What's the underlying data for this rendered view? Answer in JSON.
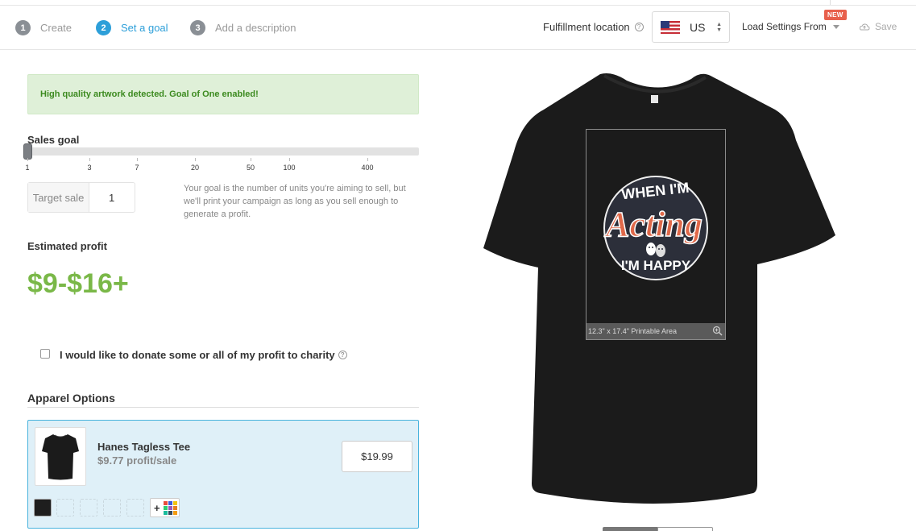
{
  "steps": [
    {
      "number": "1",
      "label": "Create"
    },
    {
      "number": "2",
      "label": "Set a goal"
    },
    {
      "number": "3",
      "label": "Add a description"
    }
  ],
  "header": {
    "fulfillment_label": "Fulfillment location",
    "country": "US",
    "load_settings_label": "Load Settings From",
    "new_badge": "NEW",
    "save_label": "Save"
  },
  "alert": {
    "text": "High quality artwork detected. Goal of One enabled!"
  },
  "sales_goal": {
    "label": "Sales goal",
    "ticks": [
      "1",
      "3",
      "7",
      "20",
      "50",
      "100",
      "400"
    ],
    "selected_value": 1,
    "target_label": "Target sale",
    "target_value": "1",
    "help_text": "Your goal is the number of units you're aiming to sell, but we'll print your campaign as long as you sell enough to generate a profit."
  },
  "estimated_profit": {
    "label": "Estimated profit",
    "value": "$9-$16+"
  },
  "donate": {
    "label": "I would like to donate some or all of my profit to charity",
    "checked": false
  },
  "apparel": {
    "section_label": "Apparel Options",
    "product_name": "Hanes Tagless Tee",
    "profit_text": "$9.77 profit/sale",
    "price": "$19.99",
    "add_color_symbol": "+"
  },
  "design": {
    "line1": "WHEN I'M",
    "line2": "Acting",
    "line3": "I'M HAPPY",
    "printable_area_text": "12.3\" x 17.4\" Printable Area"
  },
  "colors": {
    "accent": "#2d9fd9",
    "profit_green": "#7ab848",
    "alert_bg": "#dff0d8",
    "card_bg": "#dff0f8",
    "new_badge": "#e8604c",
    "shirt": "#1b1b1b",
    "design_orange": "#e0694a"
  }
}
